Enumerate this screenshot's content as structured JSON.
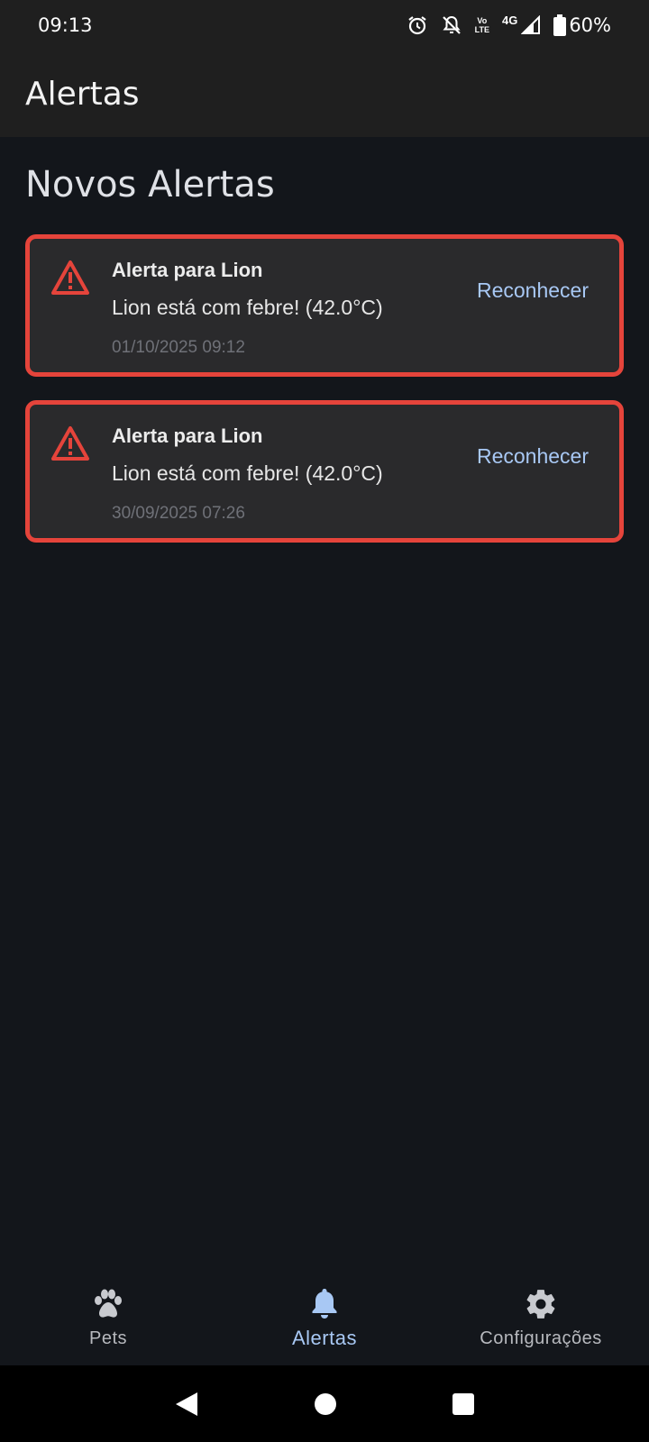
{
  "status_bar": {
    "time": "09:13",
    "network": "4G",
    "volte": [
      "Vo",
      "LTE"
    ],
    "battery": "60%"
  },
  "app_bar": {
    "title": "Alertas"
  },
  "section_title": "Novos Alertas",
  "alerts": [
    {
      "title": "Alerta para Lion",
      "message": "Lion está com febre! (42.0°C)",
      "timestamp": "01/10/2025 09:12",
      "action": "Reconhecer"
    },
    {
      "title": "Alerta para Lion",
      "message": "Lion está com febre! (42.0°C)",
      "timestamp": "30/09/2025 07:26",
      "action": "Reconhecer"
    }
  ],
  "bottom_nav": {
    "items": [
      {
        "label": "Pets",
        "icon": "paw-icon"
      },
      {
        "label": "Alertas",
        "icon": "bell-icon",
        "active": true
      },
      {
        "label": "Configurações",
        "icon": "gear-icon"
      }
    ]
  },
  "colors": {
    "background": "#13161b",
    "app_bar": "#1f1f1f",
    "card": "#2a2a2c",
    "alert_red": "#e5443b",
    "accent": "#a8c8f4"
  }
}
